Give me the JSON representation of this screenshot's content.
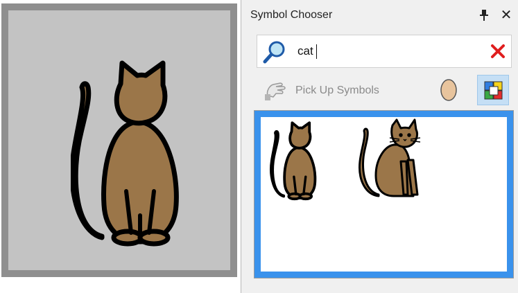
{
  "preview": {
    "symbol_icon": "cat-back-view-icon",
    "frame_color": "#8f8f8f",
    "background_color": "#c3c3c3"
  },
  "chooser": {
    "title": "Symbol Chooser",
    "pin_icon": "pin-icon",
    "close_label": "✕",
    "search": {
      "value": "cat",
      "icon": "magnifier-icon",
      "clear_icon": "red-x-icon"
    },
    "toolbar": {
      "pickup_label": "Pick Up Symbols",
      "pickup_icon": "hand-pickup-icon",
      "skin_tone_icon": "skin-tone-icon",
      "color_icon": "color-squares-icon"
    },
    "results": [
      {
        "icon": "cat-back-view-icon"
      },
      {
        "icon": "cat-sitting-side-icon"
      }
    ],
    "colors": {
      "cat_fill": "#9b7649",
      "selection_border": "#3a92ec",
      "clear_red": "#e01e1e"
    }
  }
}
